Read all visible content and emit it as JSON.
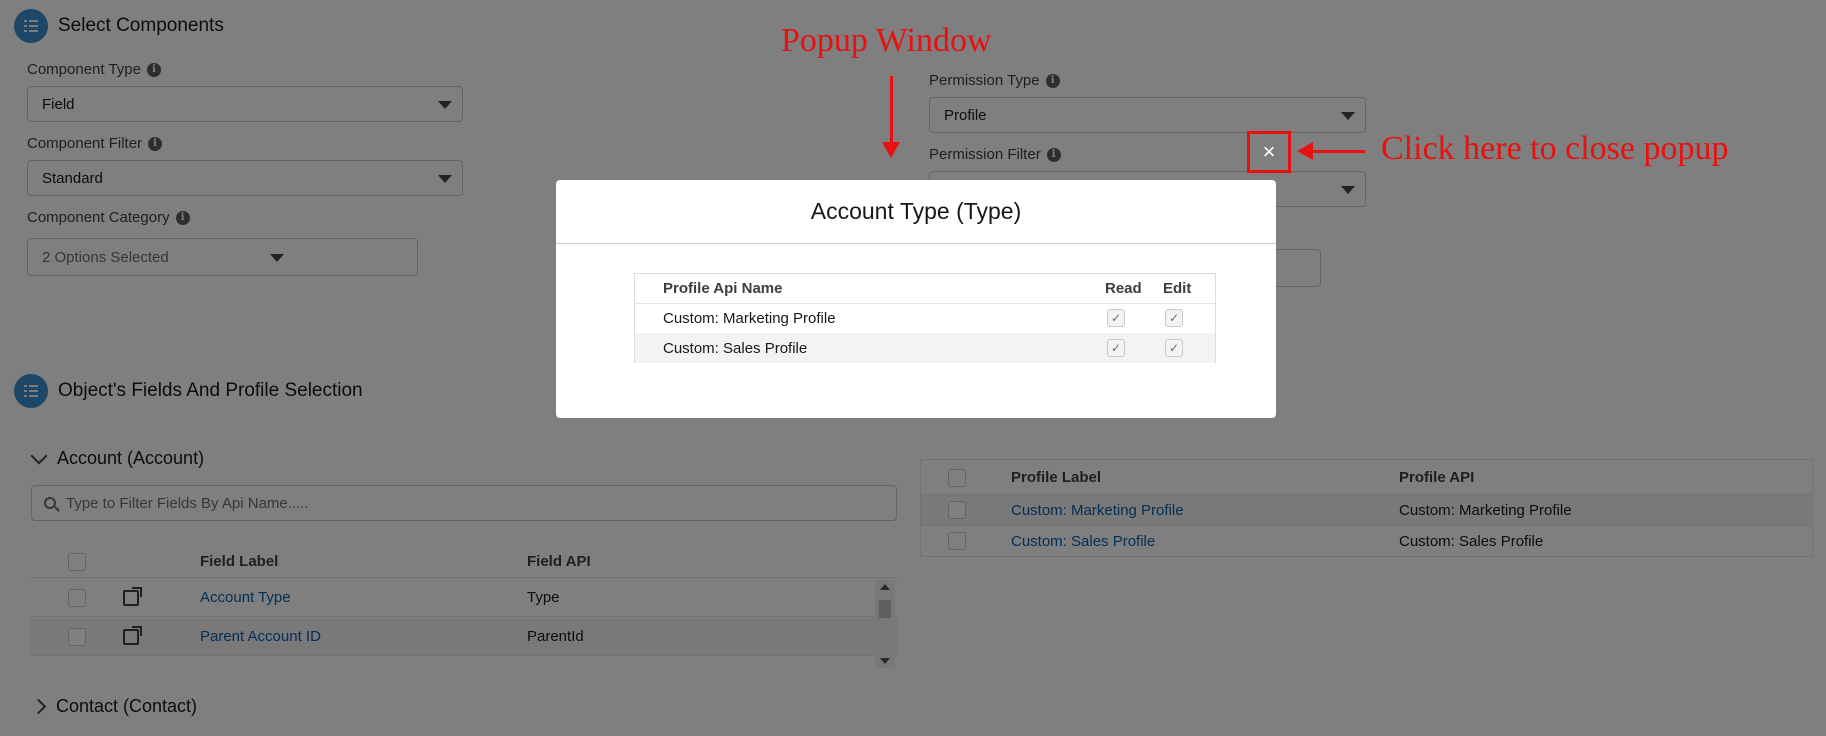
{
  "select_components": {
    "title": "Select Components",
    "component_type": {
      "label": "Component Type",
      "value": "Field"
    },
    "component_filter": {
      "label": "Component Filter",
      "value": "Standard"
    },
    "component_category": {
      "label": "Component Category",
      "value": "2 Options Selected"
    },
    "permission_type": {
      "label": "Permission Type",
      "value": "Profile"
    },
    "permission_filter": {
      "label": "Permission Filter",
      "value": ""
    }
  },
  "fields_section": {
    "title": "Object's Fields And Profile Selection",
    "account_accordion": "Account (Account)",
    "contact_accordion": "Contact (Contact)",
    "search_placeholder": "Type to Filter Fields By Api Name.....",
    "field_table": {
      "headers": {
        "label": "Field Label",
        "api": "Field API"
      },
      "rows": [
        {
          "label": "Account Type",
          "api": "Type"
        },
        {
          "label": "Parent Account ID",
          "api": "ParentId"
        }
      ]
    },
    "profile_table": {
      "headers": {
        "label": "Profile Label",
        "api": "Profile API"
      },
      "rows": [
        {
          "label": "Custom: Marketing Profile",
          "api": "Custom: Marketing Profile"
        },
        {
          "label": "Custom: Sales Profile",
          "api": "Custom: Sales Profile"
        }
      ]
    }
  },
  "modal": {
    "title": "Account Type (Type)",
    "headers": {
      "name": "Profile Api Name",
      "read": "Read",
      "edit": "Edit"
    },
    "rows": [
      {
        "name": "Custom: Marketing Profile",
        "read": true,
        "edit": true
      },
      {
        "name": "Custom: Sales Profile",
        "read": true,
        "edit": true
      }
    ],
    "close_glyph": "×"
  },
  "annotations": {
    "popup_label": "Popup Window",
    "close_label": "Click here to close popup",
    "color": "#e81010"
  },
  "colors": {
    "link": "#0b5cab",
    "section_icon": "#3a8fd1"
  }
}
